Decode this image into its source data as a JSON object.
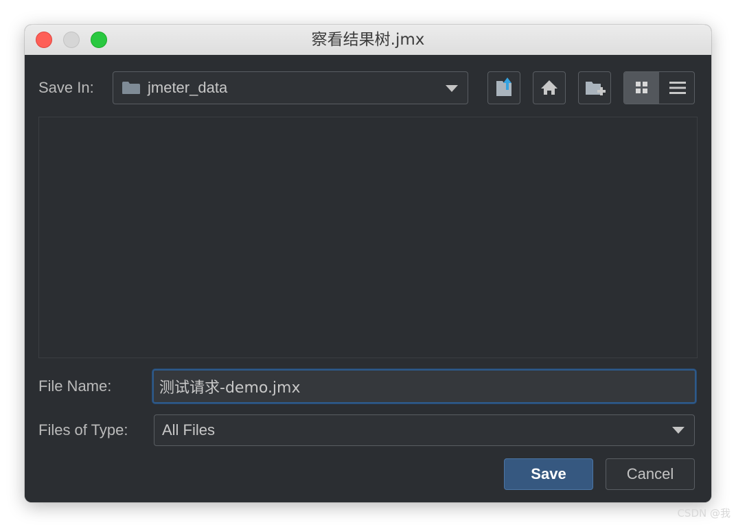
{
  "window": {
    "title": "察看结果树.jmx"
  },
  "save_in": {
    "label": "Save In:",
    "value": "jmeter_data"
  },
  "toolbar": {
    "icons": [
      "up-folder-icon",
      "home-icon",
      "new-folder-icon",
      "grid-view-icon",
      "list-view-icon"
    ],
    "active_view": "grid"
  },
  "file_name": {
    "label": "File Name:",
    "value": "测试请求-demo.jmx"
  },
  "file_type": {
    "label": "Files of Type:",
    "value": "All Files"
  },
  "buttons": {
    "save": "Save",
    "cancel": "Cancel"
  },
  "colors": {
    "background": "#2b2e32",
    "accent": "#365880",
    "focus_ring": "#2e5a8a",
    "upload_arrow": "#36a3e0"
  },
  "watermark": "CSDN @我"
}
